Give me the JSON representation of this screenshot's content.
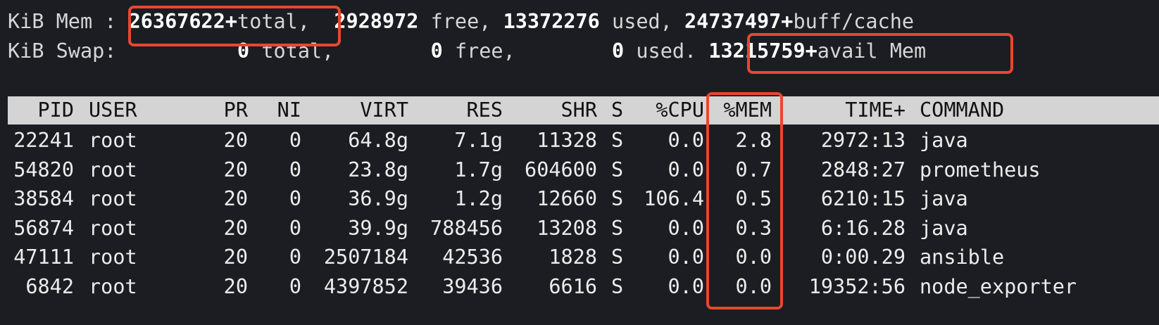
{
  "summary": {
    "mem_label": "KiB Mem :",
    "mem_total": "26367622+",
    "mem_total_suffix": "total,",
    "mem_free_value": "2928972",
    "mem_free_label": "free,",
    "mem_used_value": "13372276",
    "mem_used_label": "used,",
    "mem_buff_value": "24737497+",
    "mem_buff_label": "buff/cache",
    "swap_label": "KiB Swap:",
    "swap_total_value": "0",
    "swap_total_label": "total,",
    "swap_free_value": "0",
    "swap_free_label": "free,",
    "swap_used_value": "0",
    "swap_used_label": "used.",
    "avail_value": "13215759+",
    "avail_label": "avail Mem"
  },
  "table": {
    "headers": {
      "pid": "PID",
      "user": "USER",
      "pr": "PR",
      "ni": "NI",
      "virt": "VIRT",
      "res": "RES",
      "shr": "SHR",
      "s": "S",
      "cpu": "%CPU",
      "mem": "%MEM",
      "time": "TIME+",
      "command": "COMMAND"
    },
    "rows": [
      {
        "pid": "22241",
        "user": "root",
        "pr": "20",
        "ni": "0",
        "virt": "64.8g",
        "res": "7.1g",
        "shr": "11328",
        "s": "S",
        "cpu": "0.0",
        "mem": "2.8",
        "time": "2972:13",
        "command": "java"
      },
      {
        "pid": "54820",
        "user": "root",
        "pr": "20",
        "ni": "0",
        "virt": "23.8g",
        "res": "1.7g",
        "shr": "604600",
        "s": "S",
        "cpu": "0.0",
        "mem": "0.7",
        "time": "2848:27",
        "command": "prometheus"
      },
      {
        "pid": "38584",
        "user": "root",
        "pr": "20",
        "ni": "0",
        "virt": "36.9g",
        "res": "1.2g",
        "shr": "12660",
        "s": "S",
        "cpu": "106.4",
        "mem": "0.5",
        "time": "6210:15",
        "command": "java"
      },
      {
        "pid": "56874",
        "user": "root",
        "pr": "20",
        "ni": "0",
        "virt": "39.9g",
        "res": "788456",
        "shr": "13208",
        "s": "S",
        "cpu": "0.0",
        "mem": "0.3",
        "time": "6:16.28",
        "command": "java"
      },
      {
        "pid": "47111",
        "user": "root",
        "pr": "20",
        "ni": "0",
        "virt": "2507184",
        "res": "42536",
        "shr": "1828",
        "s": "S",
        "cpu": "0.0",
        "mem": "0.0",
        "time": "0:00.29",
        "command": "ansible"
      },
      {
        "pid": "6842",
        "user": "root",
        "pr": "20",
        "ni": "0",
        "virt": "4397852",
        "res": "39436",
        "shr": "6616",
        "s": "S",
        "cpu": "0.0",
        "mem": "0.0",
        "time": "19352:56",
        "command": "node_exporter"
      }
    ]
  },
  "colors": {
    "background": "#1c1d22",
    "text": "#ececec",
    "header_bar": "#d4d4d4",
    "annotation_red": "#e8472f"
  }
}
